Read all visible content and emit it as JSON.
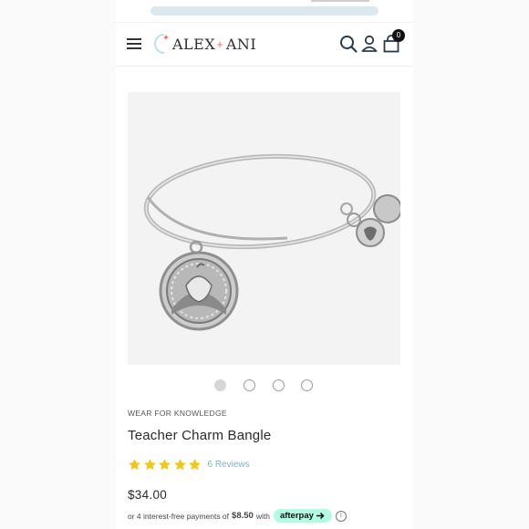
{
  "brand": {
    "name_left": "ALEX",
    "plus": "+",
    "name_right": "ANI"
  },
  "header": {
    "cart_count": "0"
  },
  "icons": {
    "menu": "hamburger-menu-icon",
    "search": "search-icon",
    "account": "user-icon",
    "cart": "shopping-bag-icon"
  },
  "product": {
    "collection": "WEAR FOR KNOWLEDGE",
    "title": "Teacher Charm Bangle",
    "rating": 5,
    "rating_max": 5,
    "reviews_label": "6 Reviews",
    "price": "$34.00",
    "image_count": 4,
    "active_image": 1
  },
  "payment": {
    "prefix": "or 4 interest-free payments of",
    "amount": "$8.50",
    "with": "with",
    "provider": "afterpay",
    "info": "i"
  },
  "colors": {
    "star": "#f5c518",
    "reviews_link": "#7fb0c4",
    "afterpay_bg": "#b2fce4",
    "logo_accent": "#e3746e",
    "logo_moon": "#a9dbe8",
    "image_bg": "#f3f3f3"
  }
}
